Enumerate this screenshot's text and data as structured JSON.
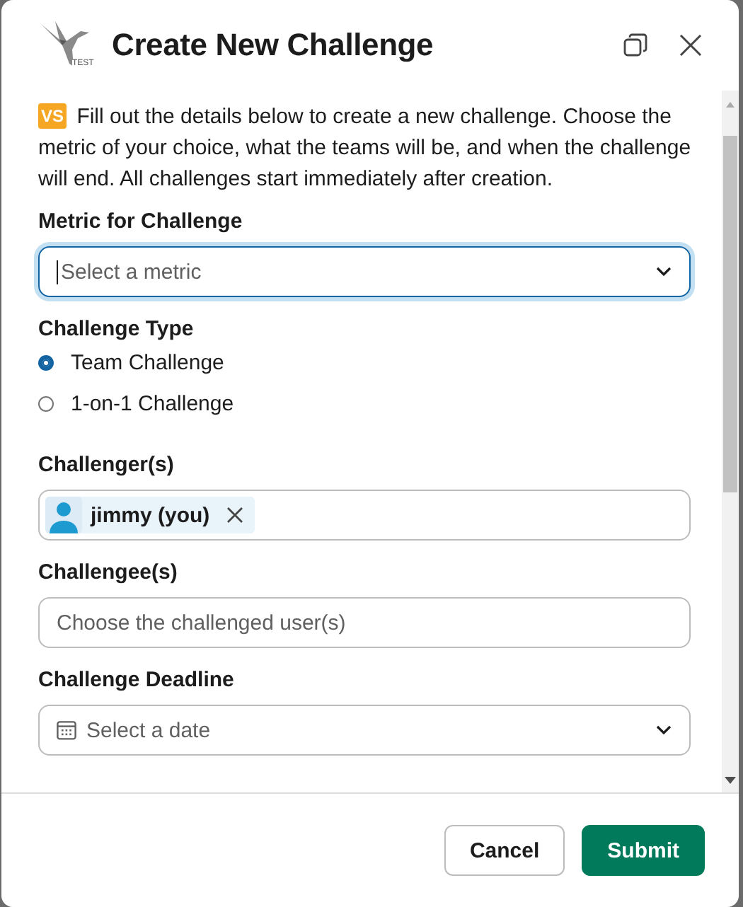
{
  "modal": {
    "logo_caption": "TEST",
    "title": "Create New Challenge"
  },
  "intro": {
    "badge": "VS",
    "text": "Fill out the details below to create a new challenge. Choose the metric of your choice, what the teams will be, and when the challenge will end. All challenges start immediately after creation."
  },
  "fields": [
    {
      "kind": "select",
      "label": "Metric for Challenge",
      "placeholder": "Select a metric",
      "focused": true
    },
    {
      "kind": "radio",
      "label": "Challenge Type",
      "options": [
        {
          "label": "Team Challenge",
          "selected": true
        },
        {
          "label": "1-on-1 Challenge",
          "selected": false
        }
      ]
    },
    {
      "kind": "users",
      "label": "Challenger(s)",
      "chips": [
        {
          "name": "jimmy (you)"
        }
      ]
    },
    {
      "kind": "users",
      "label": "Challengee(s)",
      "placeholder": "Choose the challenged user(s)"
    },
    {
      "kind": "date",
      "label": "Challenge Deadline",
      "placeholder": "Select a date",
      "focused": false
    }
  ],
  "buttons": [
    {
      "label": "Cancel",
      "kind": "secondary"
    },
    {
      "label": "Submit",
      "kind": "primary"
    }
  ]
}
